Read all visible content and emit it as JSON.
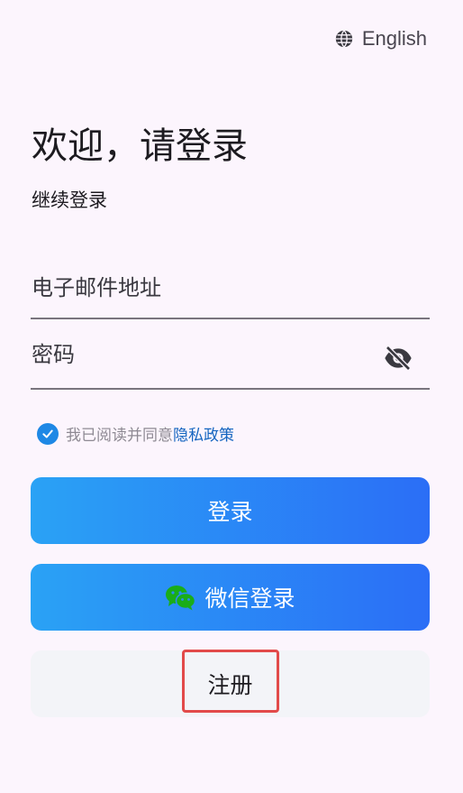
{
  "header": {
    "language_label": "English",
    "language_icon": "globe-icon"
  },
  "welcome": {
    "title": "欢迎，请登录",
    "subtitle": "继续登录"
  },
  "form": {
    "email_placeholder": "电子邮件地址",
    "email_value": "",
    "password_placeholder": "密码",
    "password_value": "",
    "password_toggle_icon": "eye-off-icon"
  },
  "agreement": {
    "checked": true,
    "text": "我已阅读并同意",
    "link_text": "隐私政策"
  },
  "buttons": {
    "login_label": "登录",
    "wechat_label": "微信登录",
    "wechat_icon": "wechat-icon",
    "register_label": "注册"
  },
  "colors": {
    "background": "#fcf5fd",
    "primary_gradient_start": "#2aa2f5",
    "primary_gradient_end": "#2b6ef6",
    "checkbox": "#1e88e5",
    "link": "#1565c0",
    "wechat_green": "#1aad19",
    "highlight_border": "#e24a4a"
  }
}
